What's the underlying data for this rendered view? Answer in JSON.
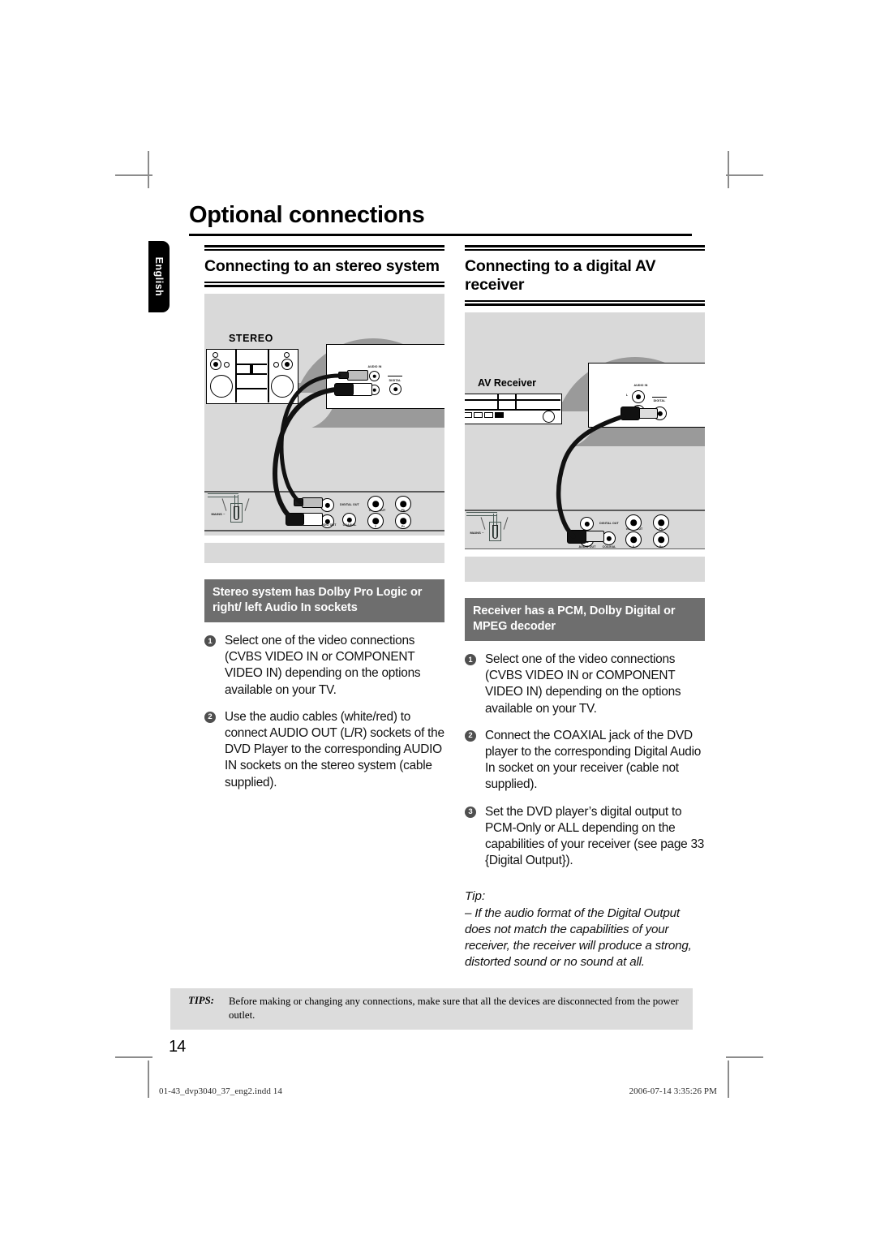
{
  "document": {
    "page_title": "Optional connections",
    "language_tab": "English",
    "page_number": "14"
  },
  "columns": [
    {
      "id": "stereo",
      "heading": "Connecting to an stereo system",
      "caption_bar": "Stereo system has Dolby Pro Logic or right/ left Audio In sockets",
      "diagram": {
        "device_label": "STEREO",
        "device_type": "stereo-mini-system",
        "source_jack_labels": [
          "AUDIO IN",
          "DIGITAL"
        ],
        "dvd_panel_labels": [
          "AUDIO OUT",
          "DIGITAL OUT",
          "COAXIAL",
          "VIDEO OUT",
          "Y",
          "Pb",
          "Pr"
        ],
        "mains_label": "MAINS ~"
      },
      "steps": [
        {
          "n": "1",
          "text": "Select one of the video connections (CVBS VIDEO IN or COMPONENT VIDEO IN) depending on the options available on your TV."
        },
        {
          "n": "2",
          "text": "Use the audio cables (white/red) to connect AUDIO OUT (L/R) sockets of the DVD Player to the corresponding AUDIO IN sockets on the stereo system (cable supplied)."
        }
      ],
      "tip": null
    },
    {
      "id": "av-receiver",
      "heading": "Connecting to a digital AV receiver",
      "caption_bar": "Receiver has a PCM, Dolby Digital or MPEG decoder",
      "diagram": {
        "device_label": "AV Receiver",
        "device_type": "av-receiver",
        "source_jack_labels": [
          "AUDIO IN",
          "L",
          "R",
          "DIGITAL"
        ],
        "dvd_panel_labels": [
          "AUDIO OUT",
          "DIGITAL OUT",
          "COAXIAL",
          "VIDEO OUT",
          "Y",
          "Pb",
          "Pr",
          "R"
        ],
        "mains_label": "MAINS ~"
      },
      "steps": [
        {
          "n": "1",
          "text": "Select one of the video connections (CVBS VIDEO IN or COMPONENT VIDEO IN) depending on the options available on your TV."
        },
        {
          "n": "2",
          "text": "Connect the COAXIAL jack of the DVD player to the corresponding Digital Audio In socket on your receiver (cable not supplied)."
        },
        {
          "n": "3",
          "text": "Set the DVD player’s digital output to PCM-Only or ALL depending on the capabilities of your receiver (see page 33 {Digital Output})."
        }
      ],
      "tip": {
        "label": "Tip:",
        "text": "– If the audio format of the Digital Output does not match the capabilities of your receiver, the receiver will produce a strong, distorted sound or no sound at all."
      }
    }
  ],
  "tips_footer": {
    "label": "TIPS:",
    "text": "Before making or changing any connections, make sure that all the devices are disconnected from the power outlet."
  },
  "imposition": {
    "left": "01-43_dvp3040_37_eng2.indd   14",
    "right": "2006-07-14   3:35:26 PM"
  },
  "colors": {
    "caption_bar_bg": "#6e6e6e",
    "diagram_bg": "#d9d9d9",
    "tips_bg": "#dcdcdc",
    "rule": "#000000"
  }
}
